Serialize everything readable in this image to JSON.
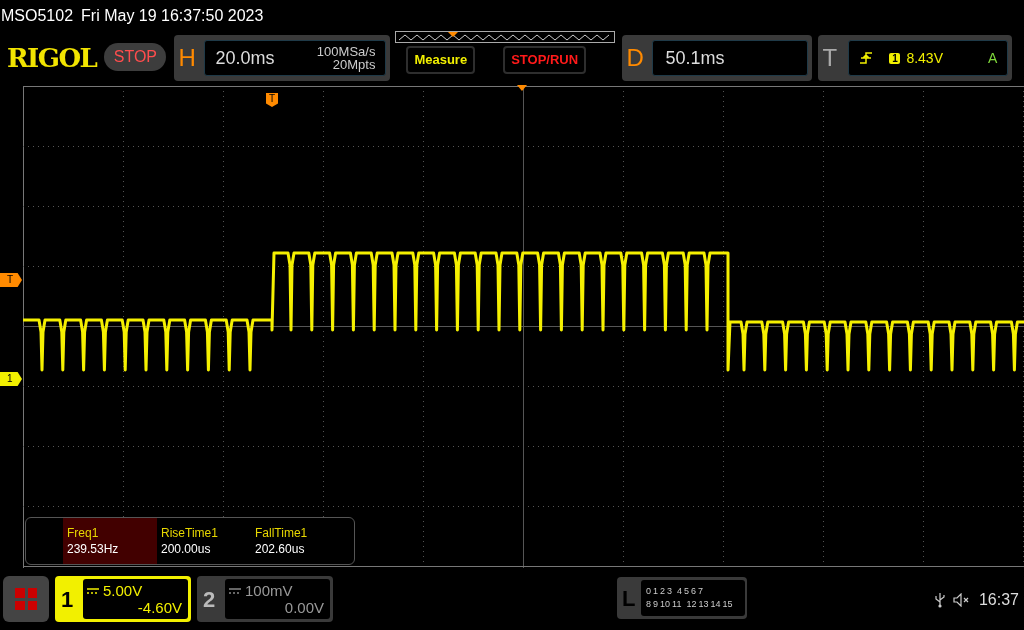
{
  "title_bar": {
    "model": "MSO5102",
    "datetime": "Fri May 19 16:37:50 2023"
  },
  "brand": "RIGOL",
  "run_state": {
    "label": "STOP",
    "running": false
  },
  "horizontal": {
    "label": "H",
    "timebase": "20.0ms",
    "sample_rate": "100MSa/s",
    "memory_depth": "20Mpts"
  },
  "buttons": [
    {
      "label": "Measure",
      "kind": "measure"
    },
    {
      "label": "STOP/RUN",
      "kind": "stoprun"
    }
  ],
  "delay": {
    "label": "D",
    "value": "50.1ms"
  },
  "trigger": {
    "label": "T",
    "source": "1",
    "level": "8.43V",
    "mode": "A"
  },
  "markers": {
    "trigger_position": "T",
    "trigger_level": "T",
    "channel_1": "1"
  },
  "measurements": [
    {
      "name": "Freq1",
      "value": "239.53Hz",
      "selected": true
    },
    {
      "name": "RiseTime1",
      "value": "200.00us",
      "selected": false
    },
    {
      "name": "FallTime1",
      "value": "202.60us",
      "selected": false
    }
  ],
  "channels": [
    {
      "number": "1",
      "scale": "5.00V",
      "offset": "-4.60V",
      "active": true
    },
    {
      "number": "2",
      "scale": "100mV",
      "offset": "0.00V",
      "active": false
    }
  ],
  "logic": {
    "label": "L",
    "row_1": [
      "0",
      "1",
      "2",
      "3",
      "4",
      "5",
      "6",
      "7"
    ],
    "row_2": [
      "8",
      "9",
      "10",
      "11",
      "12",
      "13",
      "14",
      "15"
    ]
  },
  "status": {
    "time": "16:37",
    "muted": true
  }
}
